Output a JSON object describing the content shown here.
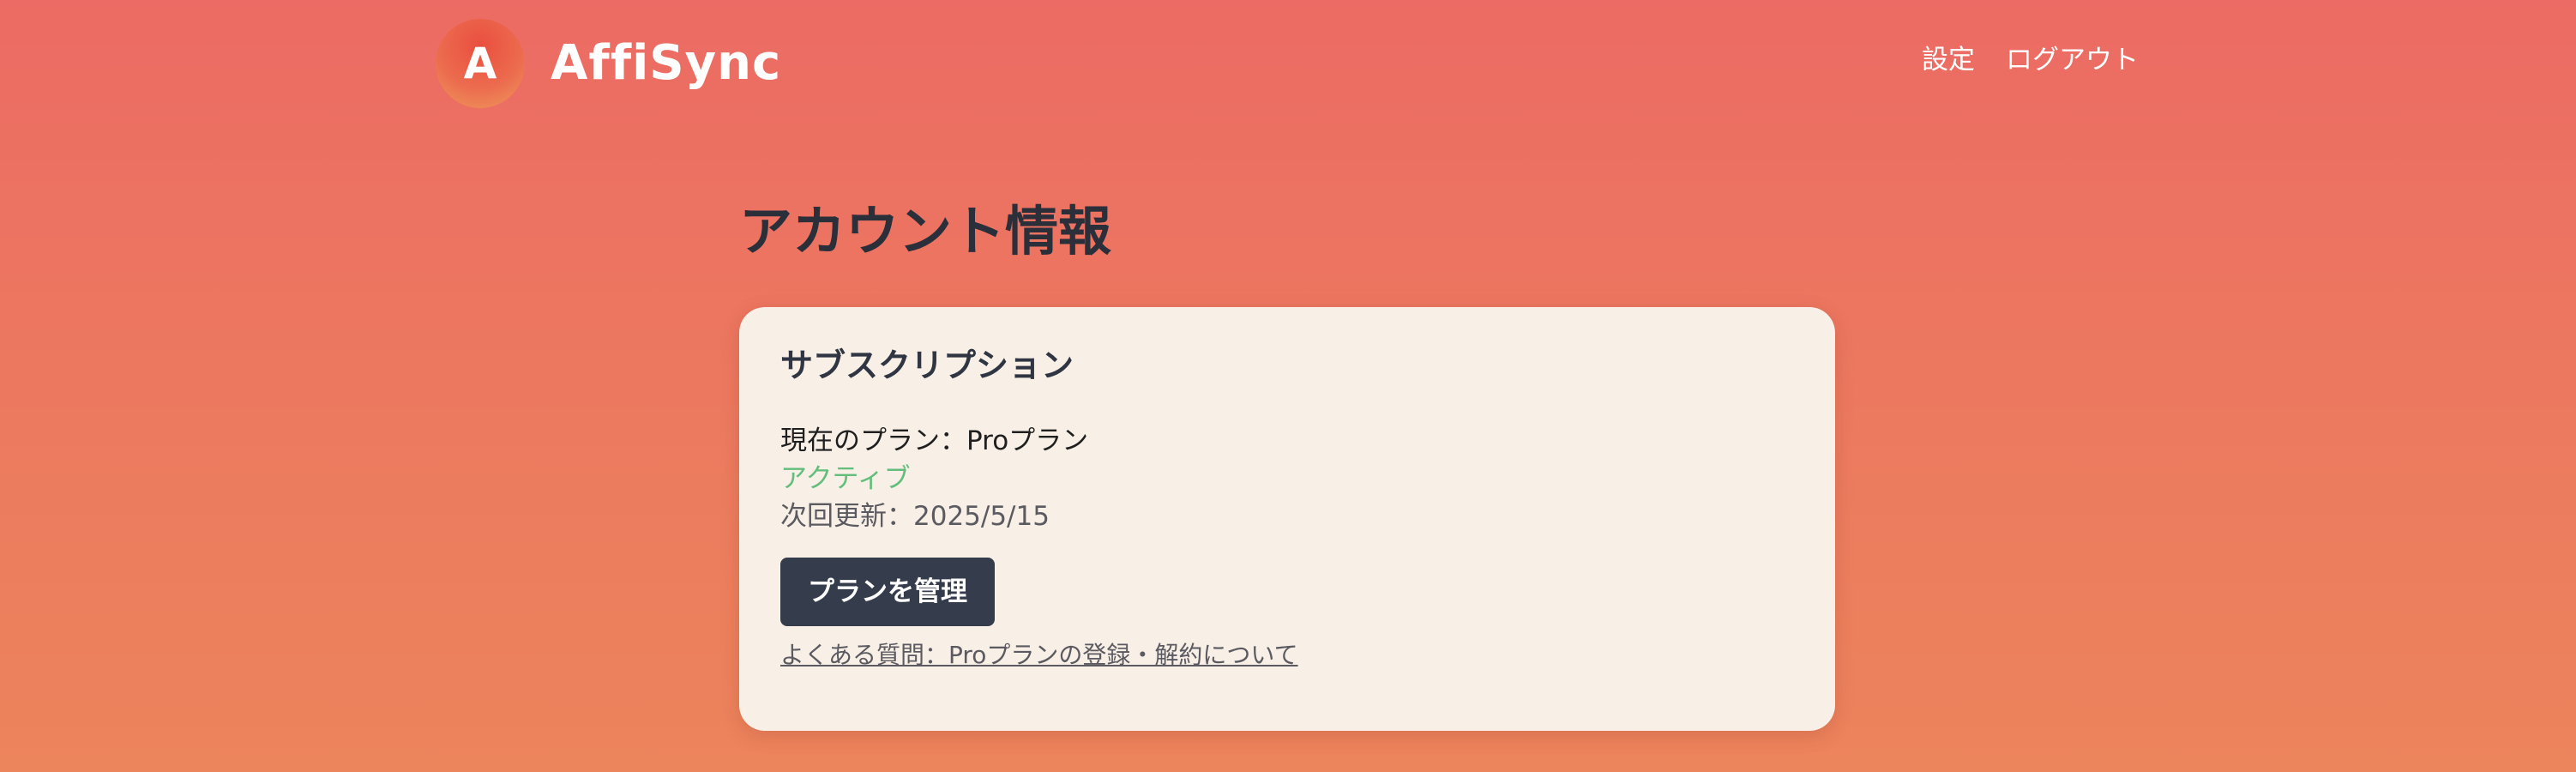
{
  "header": {
    "logo_letter": "A",
    "brand_name": "AffiSync",
    "nav": {
      "settings_label": "設定",
      "logout_label": "ログアウト"
    }
  },
  "main": {
    "page_title": "アカウント情報",
    "subscription": {
      "title": "サブスクリプション",
      "current_plan": "現在のプラン：Proプラン",
      "status": "アクティブ",
      "next_renewal": "次回更新：2025/5/15",
      "manage_button_label": "プランを管理",
      "faq_link_text": "よくある質問：Proプランの登録・解約について"
    }
  },
  "colors": {
    "background_top": "#ec6b64",
    "background_bottom": "#ec845c",
    "card_background": "#f8efe6",
    "button_background": "#353c4c",
    "status_active": "#62be7a",
    "heading_text": "#2b2f3a"
  }
}
